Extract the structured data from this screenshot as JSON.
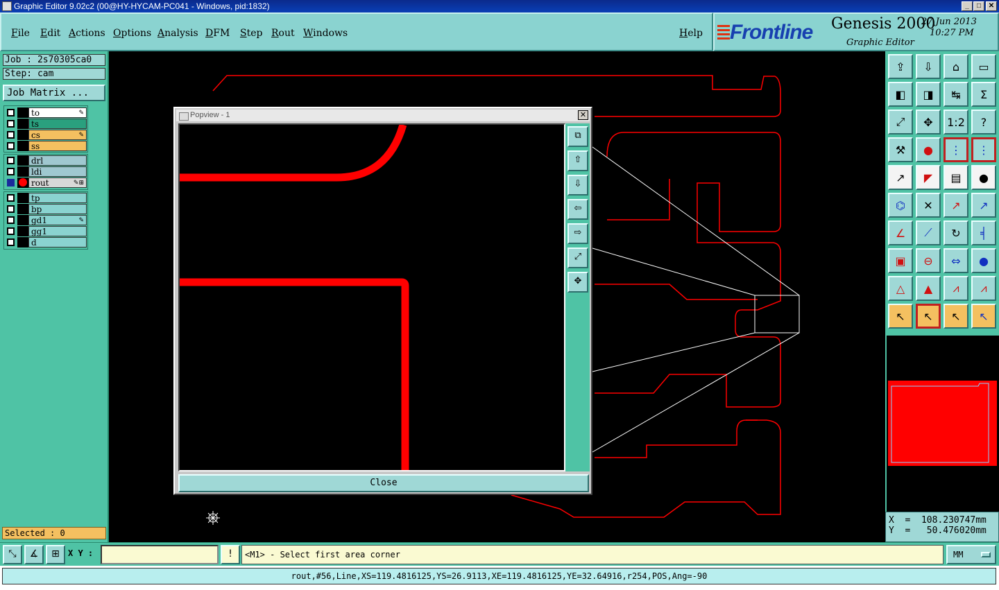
{
  "window": {
    "title": "Graphic Editor 9.02c2 (00@HY-HYCAM-PC041 - Windows, pid:1832)",
    "min": "_",
    "max": "□",
    "close": "✕"
  },
  "menu": {
    "items": [
      "File",
      "Edit",
      "Actions",
      "Options",
      "Analysis",
      "DFM",
      "Step",
      "Rout",
      "Windows"
    ],
    "help": "Help"
  },
  "brand": {
    "logo": "Frontline",
    "product": "Genesis 2000",
    "subtitle": "Graphic Editor",
    "date": "27 Jun 2013",
    "time": "10:27 PM"
  },
  "job": {
    "job_line": "Job : 2s70305ca0",
    "step_line": "Step: cam",
    "matrix_button": "Job Matrix ..."
  },
  "layers": [
    {
      "name": "to",
      "color": "#ffffff",
      "tag": "✎"
    },
    {
      "name": "ts",
      "color": "#2aa07e",
      "tag": ""
    },
    {
      "name": "cs",
      "color": "#f4c060",
      "tag": "✎"
    },
    {
      "name": "ss",
      "color": "#f4c060",
      "tag": ""
    },
    {
      "name": "drl",
      "color": "#9fc8d0",
      "tag": ""
    },
    {
      "name": "ldi",
      "color": "#9fc8d0",
      "tag": ""
    },
    {
      "name": "rout",
      "color": "#d8d8d8",
      "tag": "✎⊞"
    },
    {
      "name": "tp",
      "color": "#8ad3d0",
      "tag": ""
    },
    {
      "name": "bp",
      "color": "#8ad3d0",
      "tag": ""
    },
    {
      "name": "gd1",
      "color": "#8ad3d0",
      "tag": "✎"
    },
    {
      "name": "gg1",
      "color": "#8ad3d0",
      "tag": ""
    },
    {
      "name": "d",
      "color": "#8ad3d0",
      "tag": ""
    }
  ],
  "selected": "Selected : 0",
  "popview": {
    "title": "Popview - 1",
    "close_label": "Close",
    "close_x": "✕"
  },
  "coords": {
    "x": "X  =  108.230747mm",
    "y": "Y  =   50.476020mm"
  },
  "bottom": {
    "xy_label": "X Y :",
    "xy_value": "",
    "prompt": "<M1> - Select first area corner",
    "unit": "MM",
    "status": "rout,#56,Line,XS=119.4816125,YS=26.9113,XE=119.4816125,YE=32.64916,r254,POS,Ang=-90"
  },
  "toolbar_icons": [
    "step-up-icon",
    "step-down-icon",
    "home-icon",
    "window-icon",
    "pan-left-icon",
    "pan-right-icon",
    "swap-icon",
    "snap-icon",
    "fit-icon",
    "center-icon",
    "ratio-1-2-icon",
    "help-icon",
    "measure-icon",
    "probe-icon",
    "net-icon",
    "net-highlight-icon",
    "add-pad-icon",
    "add-line-icon",
    "ruler-icon",
    "pad-icon",
    "connect-icon",
    "delete-node-icon",
    "move-node-icon",
    "node-icon",
    "arc-angle-icon",
    "line-draw-icon",
    "arc-icon",
    "text-icon",
    "polygon-icon",
    "split-icon",
    "dimension-icon",
    "circle-icon",
    "triangle-icon",
    "triangle-up-icon",
    "contour-icon",
    "contour-alt-icon",
    "pointer-icon",
    "pointer-select-icon",
    "pointer-area-icon",
    "pointer-net-icon"
  ],
  "toolbar_glyphs": [
    "⇪",
    "⇩",
    "⌂",
    "▭",
    "◧",
    "◨",
    "↹",
    "Ʃ",
    "⤢",
    "✥",
    "1:2",
    "?",
    "⚒",
    "●",
    "⋮",
    "⋮",
    "↗",
    "◤",
    "▤",
    "●",
    "⌬",
    "✕",
    "↗",
    "↗",
    "∠",
    "⟋",
    "↻",
    "╡",
    "▣",
    "⊖",
    "⇔",
    "●",
    "△",
    "▲",
    "⩘",
    "⩘",
    "↖",
    "↖",
    "↖",
    "↖"
  ],
  "colors": {
    "panel": "#4fc3a5",
    "button": "#9fd8d6",
    "rout": "#ff0000",
    "prompt_bg": "#fafad2"
  }
}
